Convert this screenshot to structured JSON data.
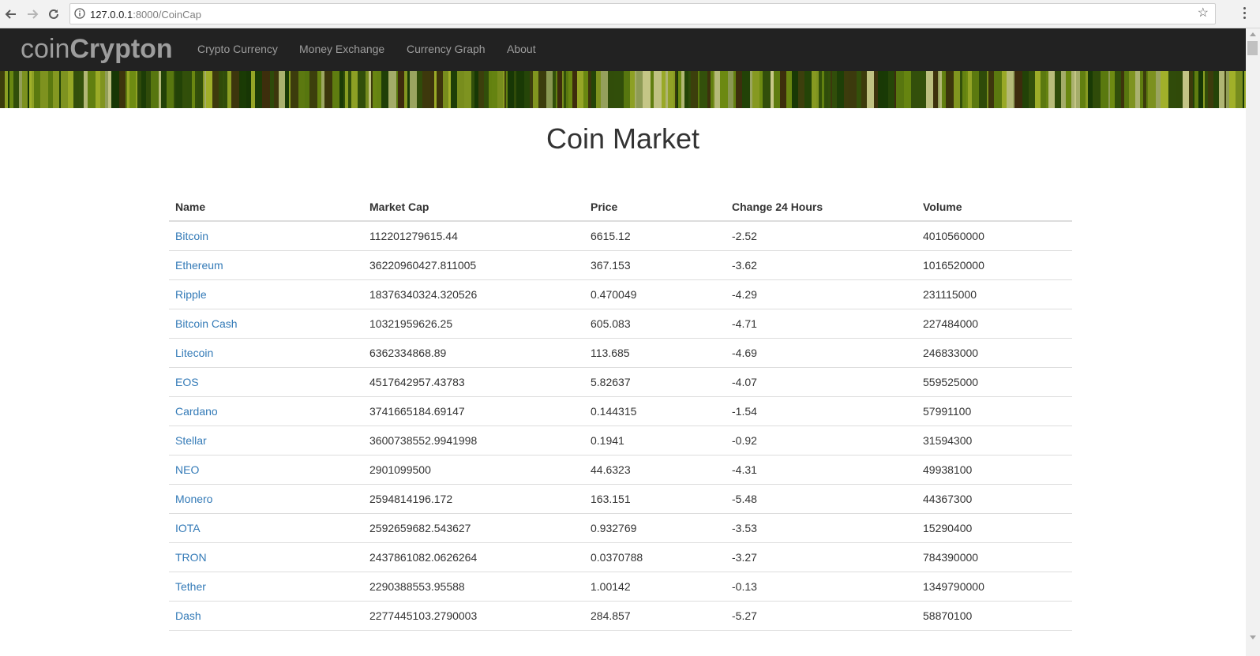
{
  "browser": {
    "url_host": "127.0.0.1",
    "url_rest": ":8000/CoinCap"
  },
  "navbar": {
    "brand_light": "coin",
    "brand_bold": "Crypton",
    "links": [
      "Crypto Currency",
      "Money Exchange",
      "Currency Graph",
      "About"
    ]
  },
  "page": {
    "title": "Coin Market"
  },
  "table": {
    "headers": [
      "Name",
      "Market Cap",
      "Price",
      "Change 24 Hours",
      "Volume"
    ],
    "rows": [
      [
        "Bitcoin",
        "112201279615.44",
        "6615.12",
        "-2.52",
        "4010560000"
      ],
      [
        "Ethereum",
        "36220960427.811005",
        "367.153",
        "-3.62",
        "1016520000"
      ],
      [
        "Ripple",
        "18376340324.320526",
        "0.470049",
        "-4.29",
        "231115000"
      ],
      [
        "Bitcoin Cash",
        "10321959626.25",
        "605.083",
        "-4.71",
        "227484000"
      ],
      [
        "Litecoin",
        "6362334868.89",
        "113.685",
        "-4.69",
        "246833000"
      ],
      [
        "EOS",
        "4517642957.43783",
        "5.82637",
        "-4.07",
        "559525000"
      ],
      [
        "Cardano",
        "3741665184.69147",
        "0.144315",
        "-1.54",
        "57991100"
      ],
      [
        "Stellar",
        "3600738552.9941998",
        "0.1941",
        "-0.92",
        "31594300"
      ],
      [
        "NEO",
        "2901099500",
        "44.6323",
        "-4.31",
        "49938100"
      ],
      [
        "Monero",
        "2594814196.172",
        "163.151",
        "-5.48",
        "44367300"
      ],
      [
        "IOTA",
        "2592659682.543627",
        "0.932769",
        "-3.53",
        "15290400"
      ],
      [
        "TRON",
        "2437861082.0626264",
        "0.0370788",
        "-3.27",
        "784390000"
      ],
      [
        "Tether",
        "2290388553.95588",
        "1.00142",
        "-0.13",
        "1349790000"
      ],
      [
        "Dash",
        "2277445103.2790003",
        "284.857",
        "-5.27",
        "58870100"
      ]
    ]
  },
  "colors": {
    "navbar_bg": "#222222",
    "nav_text": "#9d9d9d",
    "link": "#337ab7",
    "banner_tones": [
      "#2f4a0a",
      "#6f8c12",
      "#a3b12a",
      "#3e2a0d",
      "#c9c98a",
      "#153505"
    ]
  }
}
